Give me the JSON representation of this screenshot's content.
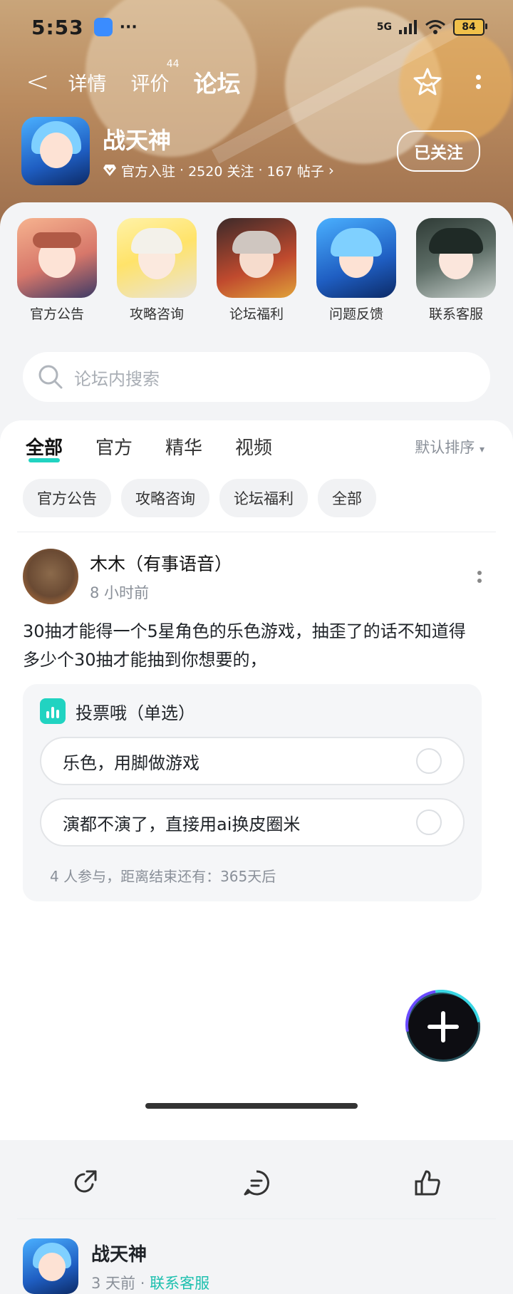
{
  "status": {
    "time": "5:53",
    "network": "5G",
    "battery": "84"
  },
  "nav": {
    "back": "<",
    "tabs": [
      {
        "label": "详情"
      },
      {
        "label": "评价",
        "badge": "44"
      },
      {
        "label": "论坛"
      }
    ]
  },
  "game": {
    "title": "战天神",
    "verified": "官方入驻",
    "followers": "2520 关注",
    "posts": "167 帖子",
    "follow_label": "已关注"
  },
  "shortcuts": [
    {
      "label": "官方公告"
    },
    {
      "label": "攻略咨询"
    },
    {
      "label": "论坛福利"
    },
    {
      "label": "问题反馈"
    },
    {
      "label": "联系客服"
    }
  ],
  "search": {
    "placeholder": "论坛内搜索"
  },
  "feed_tabs": [
    "全部",
    "官方",
    "精华",
    "视频"
  ],
  "sort_label": "默认排序",
  "chips": [
    "官方公告",
    "攻略咨询",
    "论坛福利",
    "全部"
  ],
  "post": {
    "author": "木木（有事语音）",
    "time": "8 小时前",
    "body": "30抽才能得一个5星角色的乐色游戏，抽歪了的话不知道得多少个30抽才能抽到你想要的，",
    "vote": {
      "title": "投票哦（单选）",
      "options": [
        "乐色，用脚做游戏",
        "演都不演了，直接用ai换皮圈米"
      ],
      "stat": "4 人参与，距离结束还有：365天后"
    }
  },
  "post2": {
    "author": "战天神",
    "time": "3 天前",
    "tag": "联系客服"
  },
  "colors": {
    "accent": "#21d3c1",
    "text": "#1f2328",
    "muted": "#8a9099"
  }
}
